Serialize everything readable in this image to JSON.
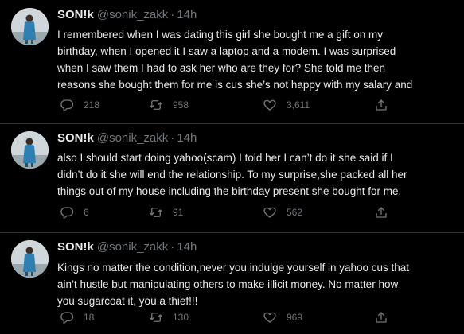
{
  "tweets": [
    {
      "author": {
        "display_name": "SON!k",
        "handle": "@sonik_zakk"
      },
      "separator": "·",
      "time": "14h",
      "lines": [
        "I remembered when I was dating this girl she bought me a gift on my",
        "birthday, when I opened it I saw a laptop and a modem. I was surprised",
        "when I saw them I had to ask her who are they for? She told me then",
        "reasons she bought them for me is cus she’s not happy with my salary and"
      ],
      "stats": {
        "replies": "218",
        "retweets": "958",
        "likes": "3,611"
      }
    },
    {
      "author": {
        "display_name": "SON!k",
        "handle": "@sonik_zakk"
      },
      "separator": "·",
      "time": "14h",
      "lines": [
        "also I should start doing yahoo(scam) I told her I can’t do it she said if I",
        "didn’t do it she will end the relationship. To my surprise,she packed all her",
        "things out of my house including the birthday present she bought for me."
      ],
      "stats": {
        "replies": "6",
        "retweets": "91",
        "likes": "562"
      }
    },
    {
      "author": {
        "display_name": "SON!k",
        "handle": "@sonik_zakk"
      },
      "separator": "·",
      "time": "14h",
      "lines": [
        "Kings no matter the condition,never you indulge yourself in yahoo cus that",
        "ain’t hustle but manipulating others to make illicit money. No matter how",
        "you sugarcoat it, you a thief!!!"
      ],
      "stats": {
        "replies": "18",
        "retweets": "130",
        "likes": "969"
      }
    }
  ],
  "icons": {
    "reply": "reply-icon",
    "retweet": "retweet-icon",
    "like": "heart-icon",
    "share": "share-icon"
  },
  "colors": {
    "background": "#000000",
    "text": "#e7e9ea",
    "muted": "#71767b",
    "divider": "#2f3336"
  }
}
